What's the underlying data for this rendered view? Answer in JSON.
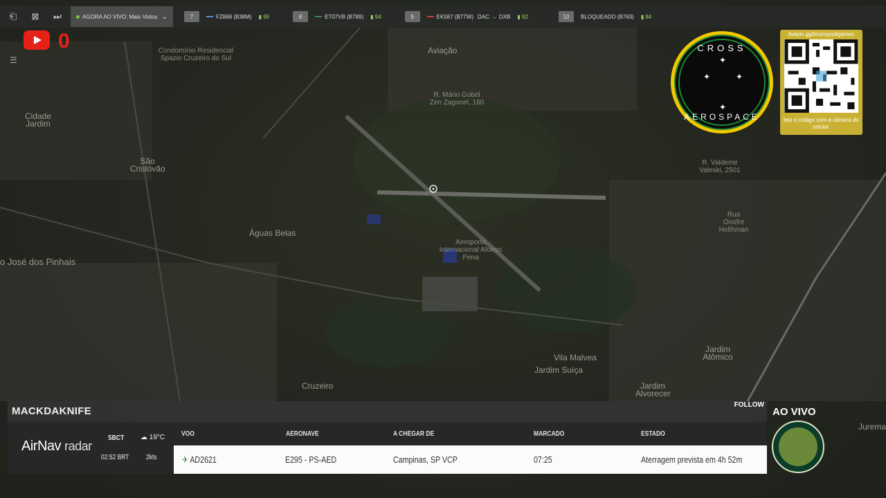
{
  "topbar": {
    "live_label": "AGORA AO VIVO: Mais Vistos",
    "flights": [
      {
        "rank": "7",
        "callsign": "FZ868 (B38M)",
        "score": "95",
        "color": "#5a8fd8"
      },
      {
        "rank": "8",
        "callsign": "ET07VB (B789)",
        "score": "94",
        "color": "#3a8a4a"
      },
      {
        "rank": "9",
        "callsign": "EK587 (B77W)",
        "route": "DAC",
        "dest": "DXB",
        "score": "92",
        "color": "#d83a3a"
      },
      {
        "rank": "10",
        "callsign": "BLOQUEADO (B763)",
        "score": "84",
        "color": "#aaaaaa"
      }
    ]
  },
  "youtube": {
    "count": "0"
  },
  "map_labels": {
    "condominio": "Condomínio Residencial Spazio Cruzeiro do Sul",
    "aviacao": "Aviação",
    "cidade_jardim": "Cidade Jardim",
    "sao_cristovao": "São Cristóvão",
    "aguas_belas": "Águas Belas",
    "jose_pinhais": "o José dos Pinhais",
    "aeroporto": "Aeroporto Internacional Afonso Pena",
    "vila_malvea": "Vila Malvea",
    "jardim_suica": "Jardim Suíça",
    "jardim_atomico": "Jardim Atômico",
    "jardim_alvorecer": "Jardim Alvorecer",
    "cruzeiro": "Cruzeiro",
    "jurema": "Jurema",
    "rua_onofre": "Rua Onofre Holthman",
    "mario_zagonel": "R. Mário Gobel Zen Zagonel, 160",
    "valeski": "R. Valdemir Valeski, 2501"
  },
  "logo": {
    "top_text": "CROSS",
    "bottom_text": "AEROSPACE"
  },
  "qr": {
    "url": "livepix.gg/brunoyudigames",
    "caption": "leia o código com a câmera do celular."
  },
  "panel": {
    "username": "MACKDAKNIFE",
    "follow": "FOLLOW",
    "brand_main": "AirNav",
    "brand_sub": "radar",
    "airport": "SBCT",
    "time": "02:52 BRT",
    "temp": "19°C",
    "wind": "2kts",
    "headers": {
      "voo": "VOO",
      "aeronave": "AERONAVE",
      "origem": "A CHEGAR DE",
      "marcado": "MARCADO",
      "estado": "ESTADO"
    },
    "row": {
      "voo": "AD2621",
      "aeronave": "E295 - PS-AED",
      "origem": "Campinas, SP VCP",
      "marcado": "07:25",
      "estado": "Aterragem prevista em 4h 52m"
    }
  },
  "ao_vivo": "AO VIVO"
}
